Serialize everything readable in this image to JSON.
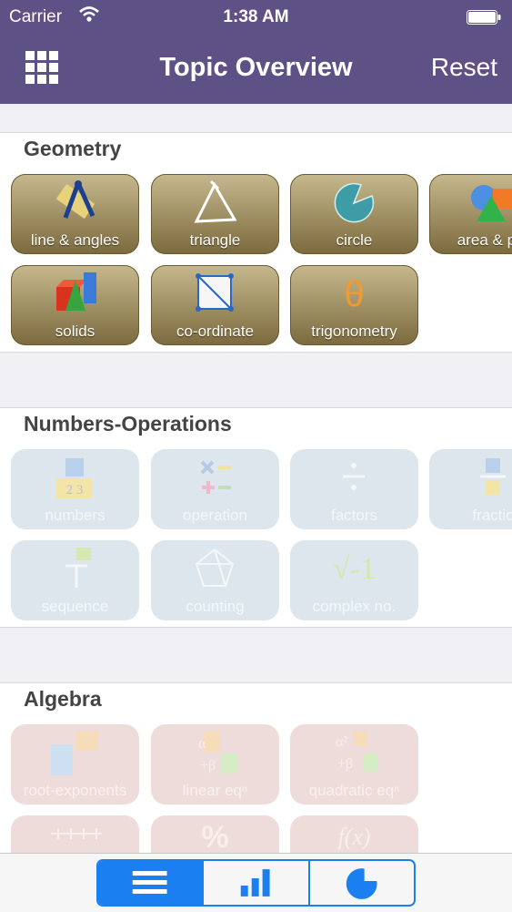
{
  "status_bar": {
    "carrier": "Carrier",
    "time": "1:38 AM"
  },
  "nav": {
    "title": "Topic Overview",
    "reset_label": "Reset",
    "menu_icon": "grid-icon"
  },
  "colors": {
    "nav": "#5e5185",
    "accent": "#1a7ff0",
    "geometry_tile": "#9c8c5e"
  },
  "sections": {
    "geometry": {
      "title": "Geometry",
      "tiles": [
        {
          "label": "line & angles",
          "icon": "compass-icon"
        },
        {
          "label": "triangle",
          "icon": "triangle-icon"
        },
        {
          "label": "circle",
          "icon": "circle-sector-icon"
        },
        {
          "label": "area & per",
          "icon": "shapes-icon"
        },
        {
          "label": "solids",
          "icon": "solids-icon"
        },
        {
          "label": "co-ordinate",
          "icon": "coordinate-icon"
        },
        {
          "label": "trigonometry",
          "icon": "theta-icon",
          "glyph": "θ"
        }
      ]
    },
    "numbers": {
      "title": "Numbers-Operations",
      "tiles": [
        {
          "label": "numbers",
          "icon": "numbers-icon",
          "glyph": "1 2 3"
        },
        {
          "label": "operation",
          "icon": "operation-icon"
        },
        {
          "label": "factors",
          "icon": "factors-icon"
        },
        {
          "label": "fractio",
          "icon": "fraction-icon"
        },
        {
          "label": "sequence",
          "icon": "sequence-icon"
        },
        {
          "label": "counting",
          "icon": "counting-icon"
        },
        {
          "label": "complex no.",
          "icon": "sqrt-icon",
          "glyph": "√-1"
        }
      ]
    },
    "algebra": {
      "title": "Algebra",
      "tiles": [
        {
          "label": "root-exponents",
          "icon": "root-exponents-icon"
        },
        {
          "label": "linear eqⁿ",
          "icon": "linear-eq-icon",
          "glyph": "α β"
        },
        {
          "label": "quadratic eqⁿ",
          "icon": "quadratic-eq-icon",
          "glyph": "α² β"
        },
        {
          "label": "",
          "icon": "number-line-icon"
        },
        {
          "label": "",
          "icon": "percent-icon",
          "glyph": "%"
        },
        {
          "label": "",
          "icon": "function-icon",
          "glyph": "f(x)"
        }
      ]
    }
  },
  "tabbar": {
    "segments": [
      {
        "name": "list",
        "icon": "list-icon",
        "selected": true
      },
      {
        "name": "stats",
        "icon": "bar-chart-icon",
        "selected": false
      },
      {
        "name": "pie",
        "icon": "pie-chart-icon",
        "selected": false
      }
    ]
  }
}
